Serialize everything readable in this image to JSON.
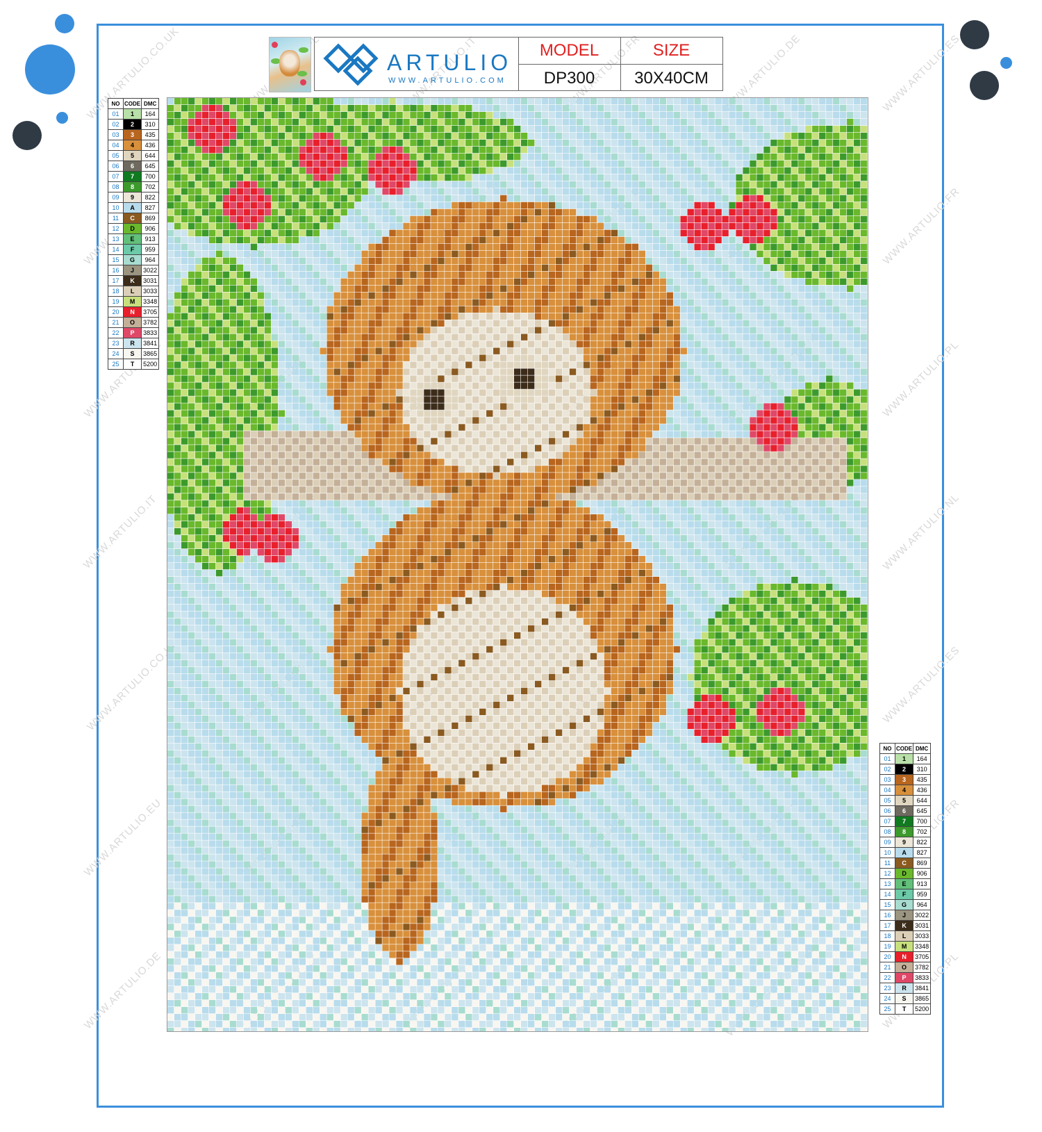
{
  "brand": {
    "name": "ARTULIO",
    "url": "WWW.ARTULIO.COM"
  },
  "spec": {
    "model_label": "MODEL",
    "model_value": "DP300",
    "size_label": "SIZE",
    "size_value": "30X40CM"
  },
  "legend": {
    "headers": [
      "NO",
      "CODE",
      "DMC"
    ],
    "rows": [
      {
        "no": "01",
        "code": "1",
        "dmc": "164",
        "color": "#b8e0a8"
      },
      {
        "no": "02",
        "code": "2",
        "dmc": "310",
        "color": "#000000"
      },
      {
        "no": "03",
        "code": "3",
        "dmc": "435",
        "color": "#b8651e"
      },
      {
        "no": "04",
        "code": "4",
        "dmc": "436",
        "color": "#d8903c"
      },
      {
        "no": "05",
        "code": "5",
        "dmc": "644",
        "color": "#e0d6c0"
      },
      {
        "no": "06",
        "code": "6",
        "dmc": "645",
        "color": "#6e6a60"
      },
      {
        "no": "07",
        "code": "7",
        "dmc": "700",
        "color": "#107a20"
      },
      {
        "no": "08",
        "code": "8",
        "dmc": "702",
        "color": "#3c9a2c"
      },
      {
        "no": "09",
        "code": "9",
        "dmc": "822",
        "color": "#ece6d8"
      },
      {
        "no": "10",
        "code": "A",
        "dmc": "827",
        "color": "#b8dcec"
      },
      {
        "no": "11",
        "code": "C",
        "dmc": "869",
        "color": "#8a5a20"
      },
      {
        "no": "12",
        "code": "D",
        "dmc": "906",
        "color": "#6ab82c"
      },
      {
        "no": "13",
        "code": "E",
        "dmc": "913",
        "color": "#62c07a"
      },
      {
        "no": "14",
        "code": "F",
        "dmc": "959",
        "color": "#6ccaa8"
      },
      {
        "no": "15",
        "code": "G",
        "dmc": "964",
        "color": "#a8dcd0"
      },
      {
        "no": "16",
        "code": "J",
        "dmc": "3022",
        "color": "#9a9480"
      },
      {
        "no": "17",
        "code": "K",
        "dmc": "3031",
        "color": "#3c2c1a"
      },
      {
        "no": "18",
        "code": "L",
        "dmc": "3033",
        "color": "#dccfb8"
      },
      {
        "no": "19",
        "code": "M",
        "dmc": "3348",
        "color": "#c8e07c"
      },
      {
        "no": "20",
        "code": "N",
        "dmc": "3705",
        "color": "#e8202c"
      },
      {
        "no": "21",
        "code": "O",
        "dmc": "3782",
        "color": "#c4b098"
      },
      {
        "no": "22",
        "code": "P",
        "dmc": "3833",
        "color": "#e04868"
      },
      {
        "no": "23",
        "code": "R",
        "dmc": "3841",
        "color": "#cce4ee"
      },
      {
        "no": "24",
        "code": "S",
        "dmc": "3865",
        "color": "#f8f6f0"
      },
      {
        "no": "25",
        "code": "T",
        "dmc": "5200",
        "color": "#ffffff"
      }
    ]
  },
  "watermarks": [
    "WWW.ARTULIO.CO.UK",
    "WWW.ARTULIO.PL",
    "WWW.ARTULIO.IT",
    "WWW.ARTULIO.FR",
    "WWW.ARTULIO.DE",
    "WWW.ARTULIO.ES",
    "WWW.ARTULIO.EU",
    "WWW.ARTULIO.NL"
  ]
}
